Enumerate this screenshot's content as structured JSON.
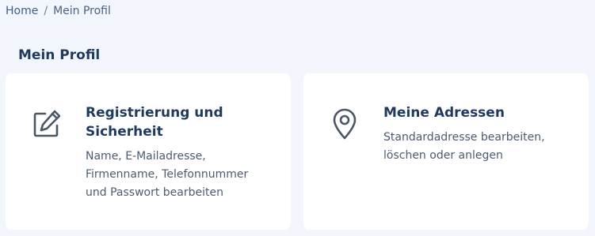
{
  "breadcrumb": {
    "home": "Home",
    "separator": "/",
    "current": "Mein Profil"
  },
  "page": {
    "title": "Mein Profil"
  },
  "cards": [
    {
      "title": "Registrierung und Sicherheit",
      "description": "Name, E-Mailadresse, Firmenname, Telefonnummer und Passwort bearbeiten",
      "icon": "edit-icon"
    },
    {
      "title": "Meine Adressen",
      "description": "Standardadresse bearbeiten, löschen oder anlegen",
      "icon": "location-pin-icon"
    }
  ],
  "colors": {
    "background": "#f2f6fc",
    "card": "#ffffff",
    "title": "#1f3a5f",
    "icon": "#4b5666"
  }
}
